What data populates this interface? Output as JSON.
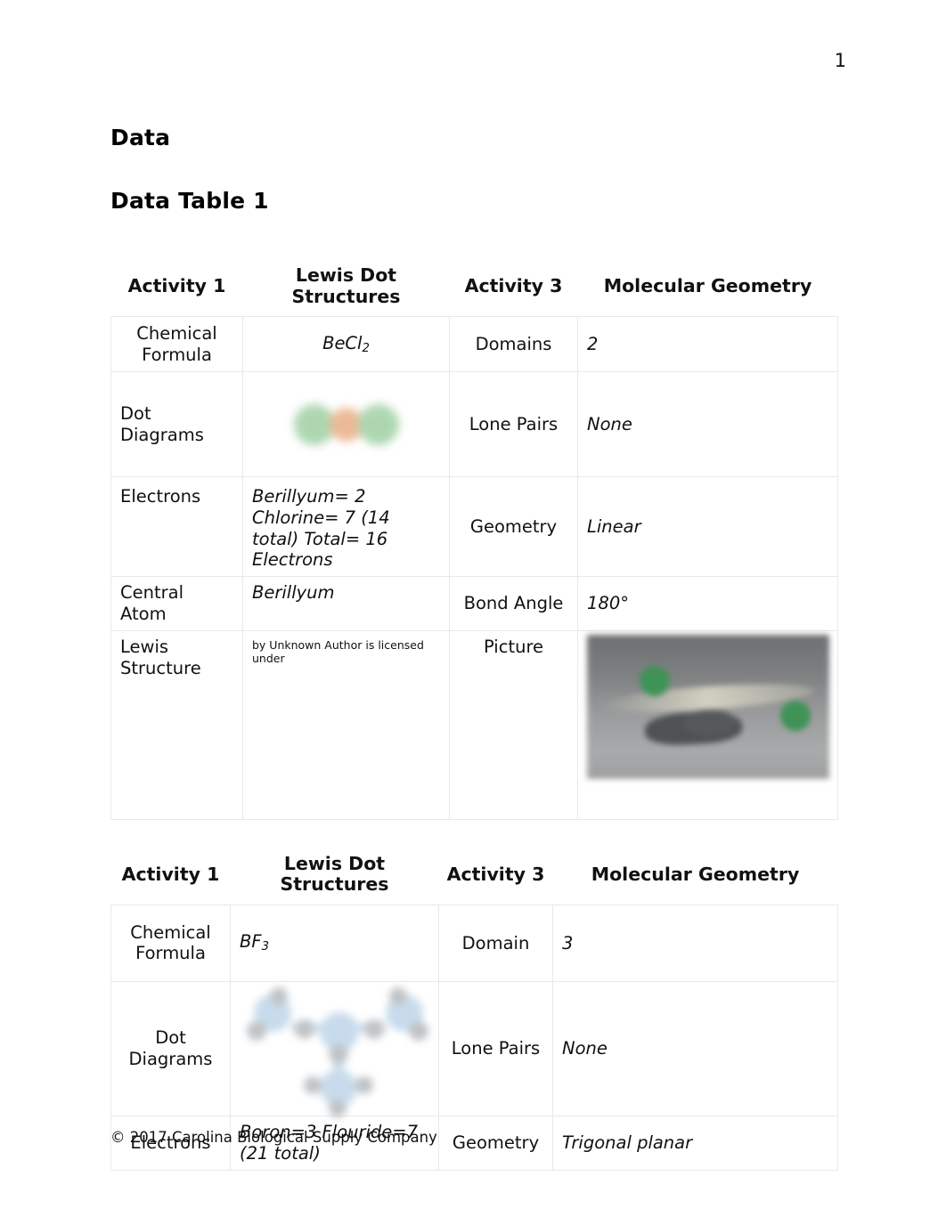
{
  "page": {
    "number": "1",
    "section_heading": "Data",
    "table_heading": "Data Table 1",
    "footer": "© 2017 Carolina Biological Supply Company"
  },
  "table1": {
    "headers": [
      "Activity 1",
      "Lewis Dot Structures",
      "Activity 3",
      "Molecular Geometry"
    ],
    "rows": [
      {
        "label": "Chemical Formula",
        "lewis_value": "BeCl",
        "lewis_sub": "2",
        "right_label": "Domains",
        "right_value": "2"
      },
      {
        "label": "Dot Diagrams",
        "figure": "becl2-ball-and-stick-diagram",
        "right_label": "Lone Pairs",
        "right_value": "None"
      },
      {
        "label": "Electrons",
        "lewis_value": "Berillyum= 2 Chlorine= 7 (14 total) Total= 16 Electrons",
        "right_label": "Geometry",
        "right_value": "Linear"
      },
      {
        "label": "Central Atom",
        "lewis_value": "Berillyum",
        "right_label": "Bond Angle",
        "right_value": "180°"
      },
      {
        "label": "Lewis Structure",
        "caption": "by Unknown Author is licensed under",
        "right_label": "Picture",
        "figure": "becl2-molecular-model-photo"
      }
    ]
  },
  "table2": {
    "headers": [
      "Activity 1",
      "Lewis Dot Structures",
      "Activity 3",
      "Molecular Geometry"
    ],
    "rows": [
      {
        "label": "Chemical Formula",
        "lewis_value": "BF",
        "lewis_sub": "3",
        "right_label": "Domain",
        "right_value": "3"
      },
      {
        "label": "Dot Diagrams",
        "figure": "bf3-lewis-dot-diagram",
        "right_label": "Lone Pairs",
        "right_value": "None"
      },
      {
        "label": "Electrons",
        "lewis_value": "Boron=3 Flouride=7 (21 total)",
        "right_label": "Geometry",
        "right_value": "Trigonal planar"
      }
    ]
  },
  "colors": {
    "accent_blue": "#2e75b6",
    "grid_line": "#e9e9e9",
    "text": "#111111"
  }
}
